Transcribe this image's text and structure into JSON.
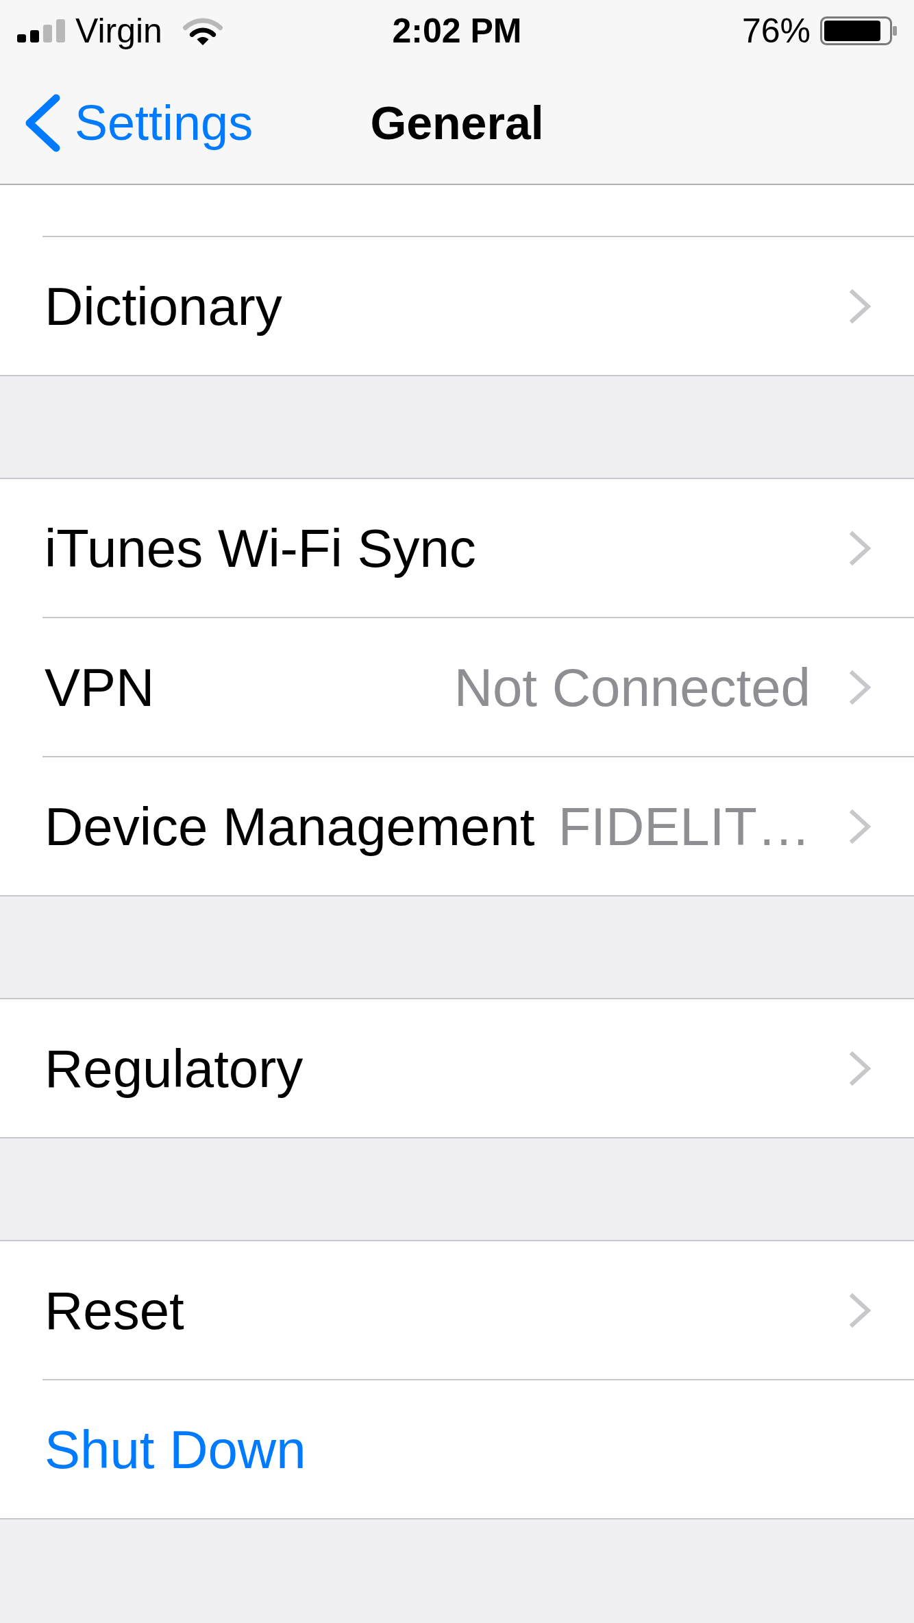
{
  "status_bar": {
    "carrier": "Virgin",
    "time": "2:02 PM",
    "battery": "76%"
  },
  "nav_bar": {
    "back": "Settings",
    "title": "General"
  },
  "groups": [
    {
      "rows": [
        {
          "kind": "disclosure",
          "label": "Dictionary"
        }
      ]
    },
    {
      "rows": [
        {
          "kind": "disclosure",
          "label": "iTunes Wi-Fi Sync"
        },
        {
          "kind": "disclosure",
          "label": "VPN",
          "value": "Not Connected"
        },
        {
          "kind": "disclosure",
          "label": "Device Management",
          "value": "FIDELIT…"
        }
      ]
    },
    {
      "rows": [
        {
          "kind": "disclosure",
          "label": "Regulatory"
        }
      ]
    },
    {
      "rows": [
        {
          "kind": "disclosure",
          "label": "Reset"
        },
        {
          "kind": "action",
          "label": "Shut Down"
        }
      ]
    }
  ]
}
